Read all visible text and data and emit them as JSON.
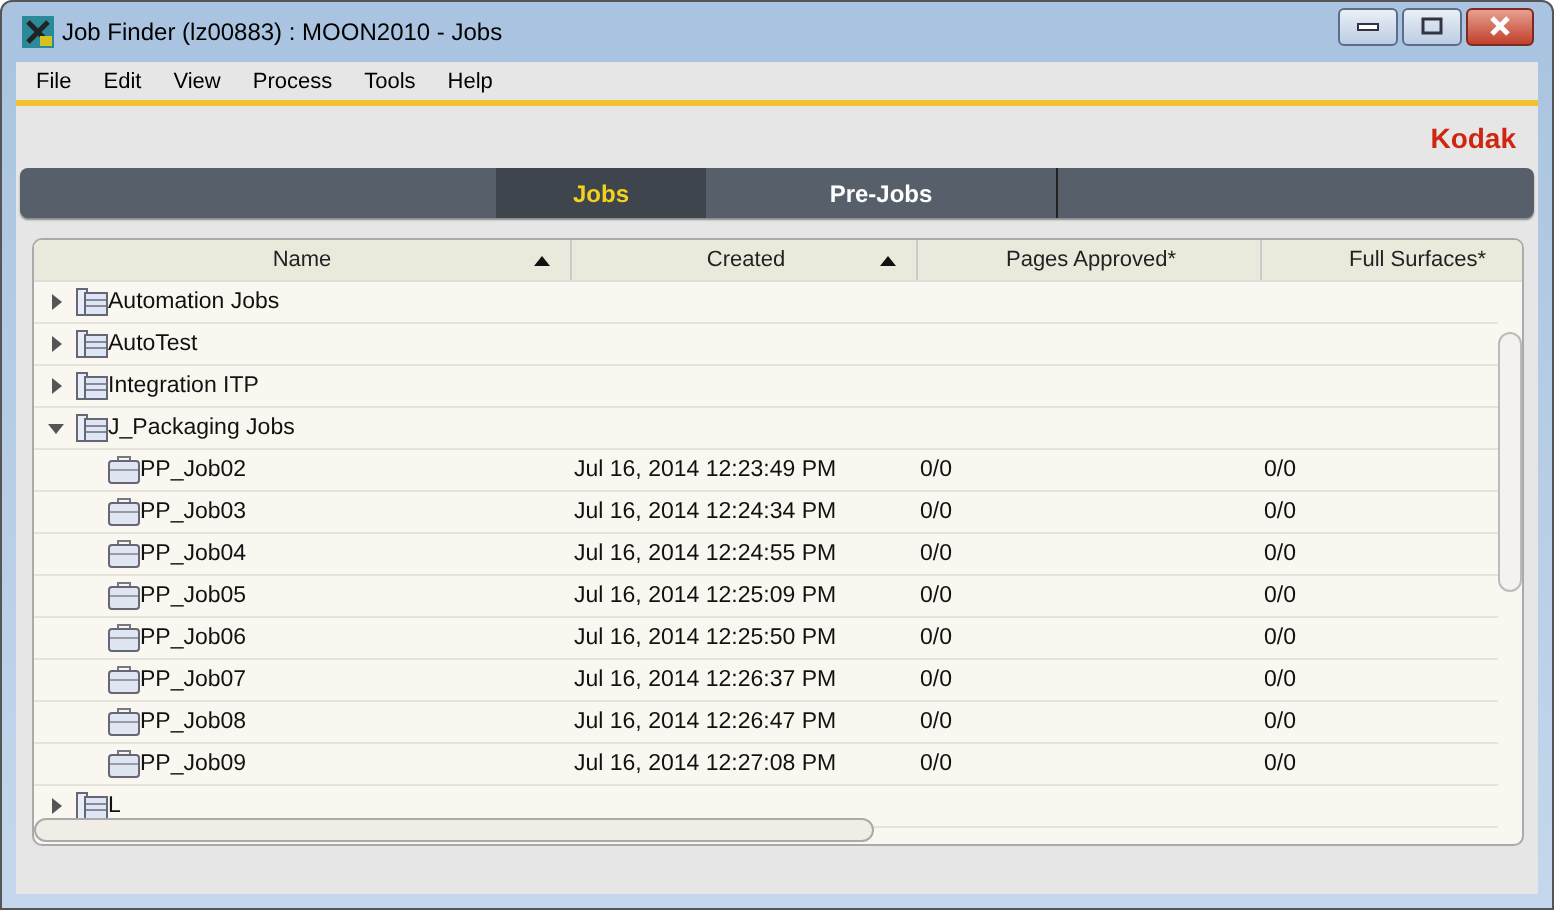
{
  "window": {
    "title": "Job Finder (lz00883) : MOON2010 - Jobs"
  },
  "menu": [
    "File",
    "Edit",
    "View",
    "Process",
    "Tools",
    "Help"
  ],
  "brand": "Kodak",
  "tabs": [
    {
      "label": "Jobs",
      "selected": true
    },
    {
      "label": "Pre-Jobs",
      "selected": false
    }
  ],
  "table": {
    "columns": [
      {
        "label": "Name",
        "sorted": true
      },
      {
        "label": "Created",
        "sorted": true
      },
      {
        "label": "Pages Approved*",
        "sorted": false
      },
      {
        "label": "Full Surfaces*",
        "sorted": false
      }
    ],
    "rows": [
      {
        "name": "Automation Jobs",
        "expanded": false
      },
      {
        "name": "AutoTest",
        "expanded": false
      },
      {
        "name": "Integration ITP",
        "expanded": false
      },
      {
        "name": "J_Packaging Jobs",
        "expanded": true,
        "children": [
          {
            "name": "PP_Job02",
            "created": "Jul 16, 2014 12:23:49 PM",
            "pages_approved": "0/0",
            "full_surfaces": "0/0"
          },
          {
            "name": "PP_Job03",
            "created": "Jul 16, 2014 12:24:34 PM",
            "pages_approved": "0/0",
            "full_surfaces": "0/0"
          },
          {
            "name": "PP_Job04",
            "created": "Jul 16, 2014 12:24:55 PM",
            "pages_approved": "0/0",
            "full_surfaces": "0/0"
          },
          {
            "name": "PP_Job05",
            "created": "Jul 16, 2014 12:25:09 PM",
            "pages_approved": "0/0",
            "full_surfaces": "0/0"
          },
          {
            "name": "PP_Job06",
            "created": "Jul 16, 2014 12:25:50 PM",
            "pages_approved": "0/0",
            "full_surfaces": "0/0"
          },
          {
            "name": "PP_Job07",
            "created": "Jul 16, 2014 12:26:37 PM",
            "pages_approved": "0/0",
            "full_surfaces": "0/0"
          },
          {
            "name": "PP_Job08",
            "created": "Jul 16, 2014 12:26:47 PM",
            "pages_approved": "0/0",
            "full_surfaces": "0/0"
          },
          {
            "name": "PP_Job09",
            "created": "Jul 16, 2014 12:27:08 PM",
            "pages_approved": "0/0",
            "full_surfaces": "0/0"
          }
        ]
      },
      {
        "name": "L",
        "expanded": false
      }
    ]
  }
}
